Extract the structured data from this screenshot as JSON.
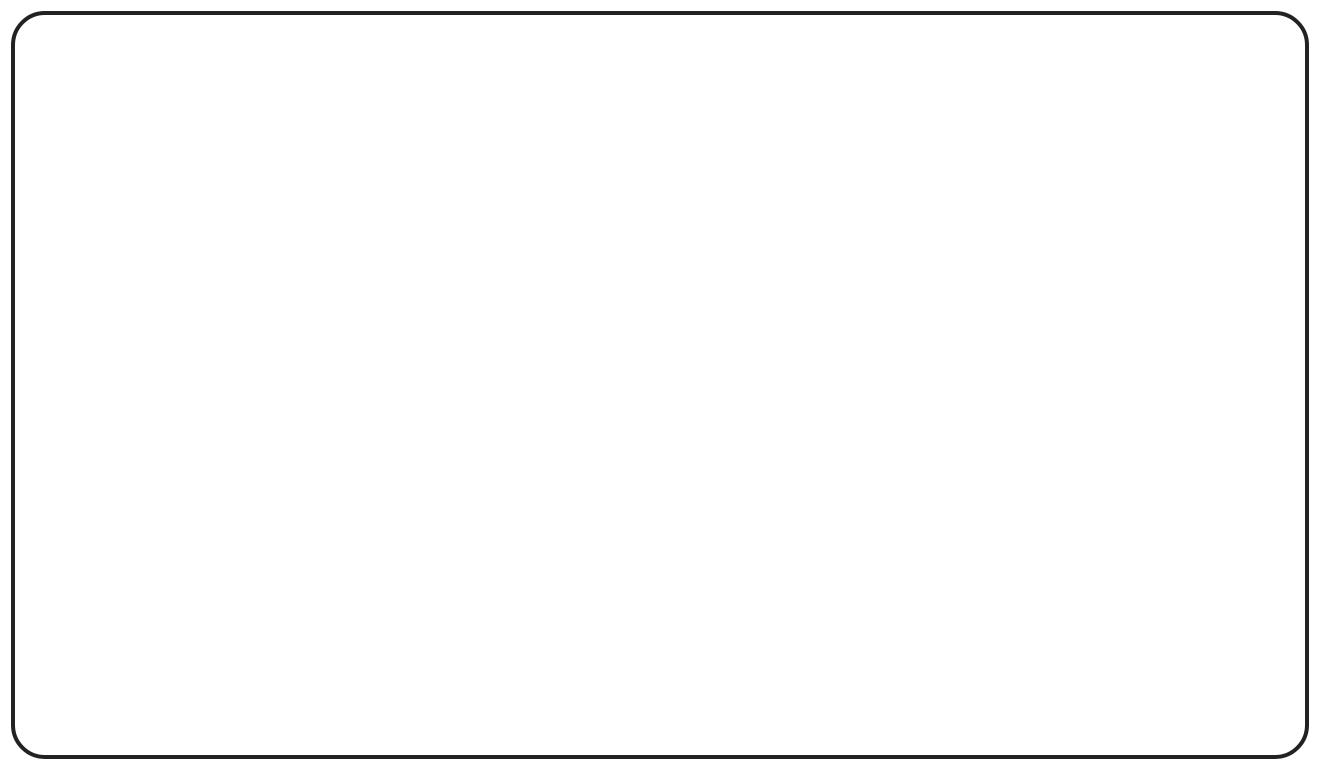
{
  "frame": {
    "border_color": "#222222",
    "fill_color": "#ffffff"
  }
}
